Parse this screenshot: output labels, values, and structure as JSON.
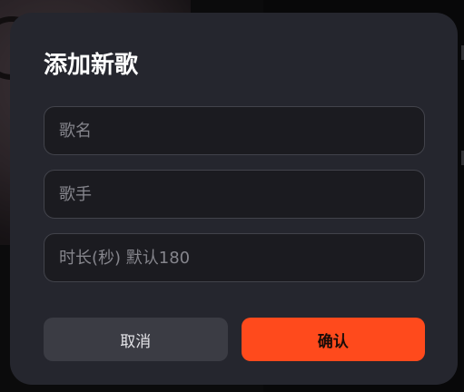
{
  "dialog": {
    "title": "添加新歌",
    "fields": {
      "song_name_placeholder": "歌名",
      "artist_placeholder": "歌手",
      "duration_placeholder": "时长(秒) 默认180",
      "song_name_value": "",
      "artist_value": "",
      "duration_value": ""
    },
    "buttons": {
      "cancel_label": "取消",
      "confirm_label": "确认"
    }
  },
  "colors": {
    "modal_background": "#25262e",
    "input_background": "#1b1b20",
    "input_border": "#42434b",
    "cancel_button": "#3b3c44",
    "confirm_button": "#ff4a1c"
  }
}
